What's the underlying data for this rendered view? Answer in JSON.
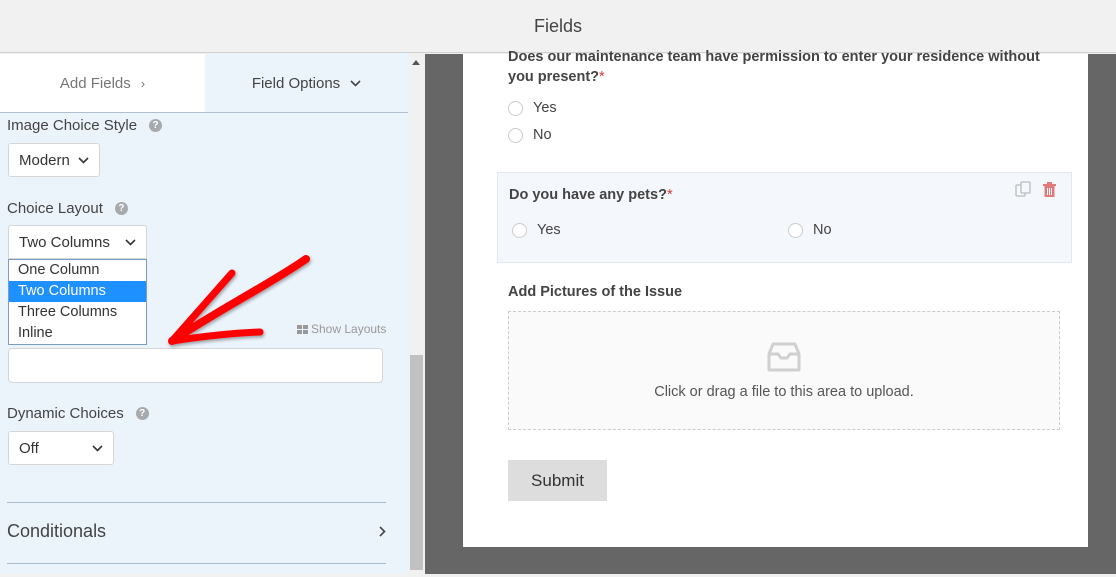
{
  "header": {
    "title": "Fields"
  },
  "tabs": {
    "add_fields": {
      "label": "Add Fields",
      "icon": "chevron-right-icon",
      "glyph": "›"
    },
    "field_options": {
      "label": "Field Options",
      "icon": "chevron-down-icon",
      "glyph": "⌄"
    }
  },
  "options": {
    "image_choice_style": {
      "label": "Image Choice Style",
      "value": "Modern"
    },
    "choice_layout": {
      "label": "Choice Layout",
      "value": "Two Columns",
      "dropdown_items": [
        "One Column",
        "Two Columns",
        "Three Columns",
        "Inline"
      ],
      "selected_index": 1
    },
    "show_layouts": "Show Layouts",
    "dynamic_choices": {
      "label": "Dynamic Choices",
      "value": "Off"
    },
    "conditionals": {
      "label": "Conditionals"
    },
    "help_glyph": "?"
  },
  "form": {
    "field1": {
      "label": "Does our maintenance team have permission to enter your residence without you present?",
      "required_marker": "*",
      "choices": [
        "Yes",
        "No"
      ]
    },
    "field2": {
      "label": "Do you have any pets?",
      "required_marker": "*",
      "choices": [
        "Yes",
        "No"
      ]
    },
    "field3": {
      "label": "Add Pictures of the Issue",
      "upload_text": "Click or drag a file to this area to upload."
    },
    "submit_label": "Submit"
  },
  "colors": {
    "sidebar_bg": "#ebf3fb",
    "selected_option": "#1e90ff",
    "annotation_arrow": "#ff0000",
    "required": "#d63638",
    "delete_icon": "#e27a7a"
  }
}
